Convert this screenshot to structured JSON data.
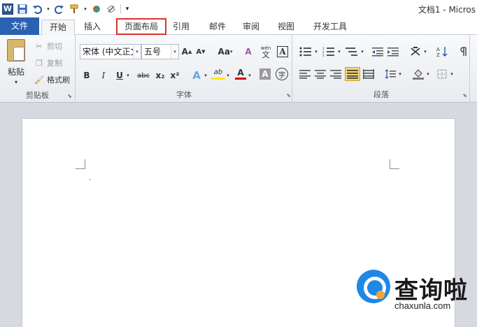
{
  "titlebar": {
    "app_icon": "W",
    "title": "文档1 - Micros"
  },
  "qat_icons": [
    "save-icon",
    "undo-icon",
    "redo-icon",
    "format-painter-icon",
    "color-icon",
    "no-format-icon",
    "customize-icon"
  ],
  "tabs": {
    "file": "文件",
    "home": "开始",
    "insert": "插入",
    "layout": "页面布局",
    "references": "引用",
    "mailings": "邮件",
    "review": "审阅",
    "view": "视图",
    "developer": "开发工具"
  },
  "clipboard": {
    "paste": "粘贴",
    "cut": "剪切",
    "copy": "复制",
    "format_painter": "格式刷",
    "group_label": "剪贴板"
  },
  "font": {
    "name": "宋体 (中文正文)",
    "size": "五号",
    "group_label": "字体",
    "grow": "A",
    "shrink": "A",
    "change_case": "Aa",
    "clear_format": "A",
    "phonetic": "wén",
    "char_border": "A",
    "bold": "B",
    "italic": "I",
    "underline": "U",
    "strikethrough": "abc",
    "subscript": "x₂",
    "superscript": "x²",
    "text_effects": "A",
    "highlight": "ab",
    "font_color": "A",
    "char_shading": "A",
    "enclose": "字"
  },
  "paragraph": {
    "group_label": "段落"
  },
  "colors": {
    "file_tab": "#2a62b1",
    "highlight_box": "#d9332e",
    "font_color_underline": "#d40000",
    "highlight_underline": "#ffe800"
  },
  "watermark": {
    "title": "查询啦",
    "url": "chaxunla.com"
  }
}
